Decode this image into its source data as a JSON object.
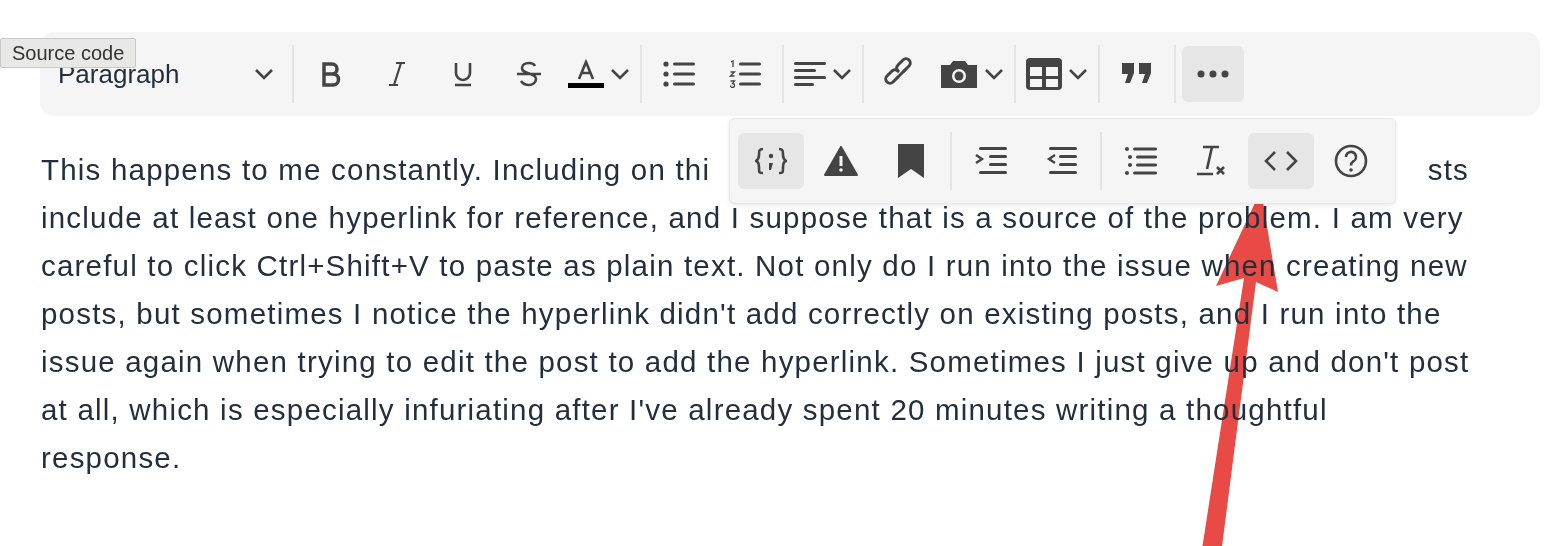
{
  "tooltip": {
    "text": "Source code"
  },
  "toolbar": {
    "block_format": "Paragraph",
    "groups": [
      [
        {
          "selected": false,
          "dropdown": false
        },
        {
          "selected": false,
          "dropdown": false
        },
        {
          "selected": false,
          "dropdown": false
        },
        {
          "selected": false,
          "dropdown": false
        },
        {
          "selected": false,
          "dropdown": true
        }
      ],
      [
        {
          "selected": false,
          "dropdown": false
        },
        {
          "selected": false,
          "dropdown": false
        }
      ],
      [
        {
          "selected": false,
          "dropdown": true
        }
      ],
      [
        {
          "selected": false,
          "dropdown": false
        },
        {
          "selected": false,
          "dropdown": true
        }
      ],
      [
        {
          "selected": false,
          "dropdown": true
        }
      ],
      [
        {
          "selected": false,
          "dropdown": false
        }
      ],
      [
        {
          "selected": true,
          "dropdown": false
        }
      ]
    ]
  },
  "overflow_toolbar": {
    "groups": [
      [
        {
          "selected": true
        },
        {
          "selected": false
        },
        {
          "selected": false
        }
      ],
      [
        {
          "selected": false
        },
        {
          "selected": false
        }
      ],
      [
        {
          "selected": false
        },
        {
          "selected": false
        },
        {
          "selected": true
        },
        {
          "selected": false
        }
      ]
    ]
  },
  "content": {
    "first_line": [
      "This happens to me constantly. Including on thi",
      "sts"
    ],
    "lines": [
      "include at least one hyperlink for reference, and I suppose that is a source of the problem. I am very",
      "careful to click Ctrl+Shift+V to paste as plain text. Not only do I run into the issue when creating new",
      "posts, but sometimes I notice the hyperlink didn't add correctly on existing posts, and I run into the",
      "issue again when trying to edit the post to add the hyperlink. Sometimes I just give up and don't post",
      "at all, which is especially infuriating after I've already spent 20 minutes writing a thoughtful",
      "response."
    ]
  }
}
